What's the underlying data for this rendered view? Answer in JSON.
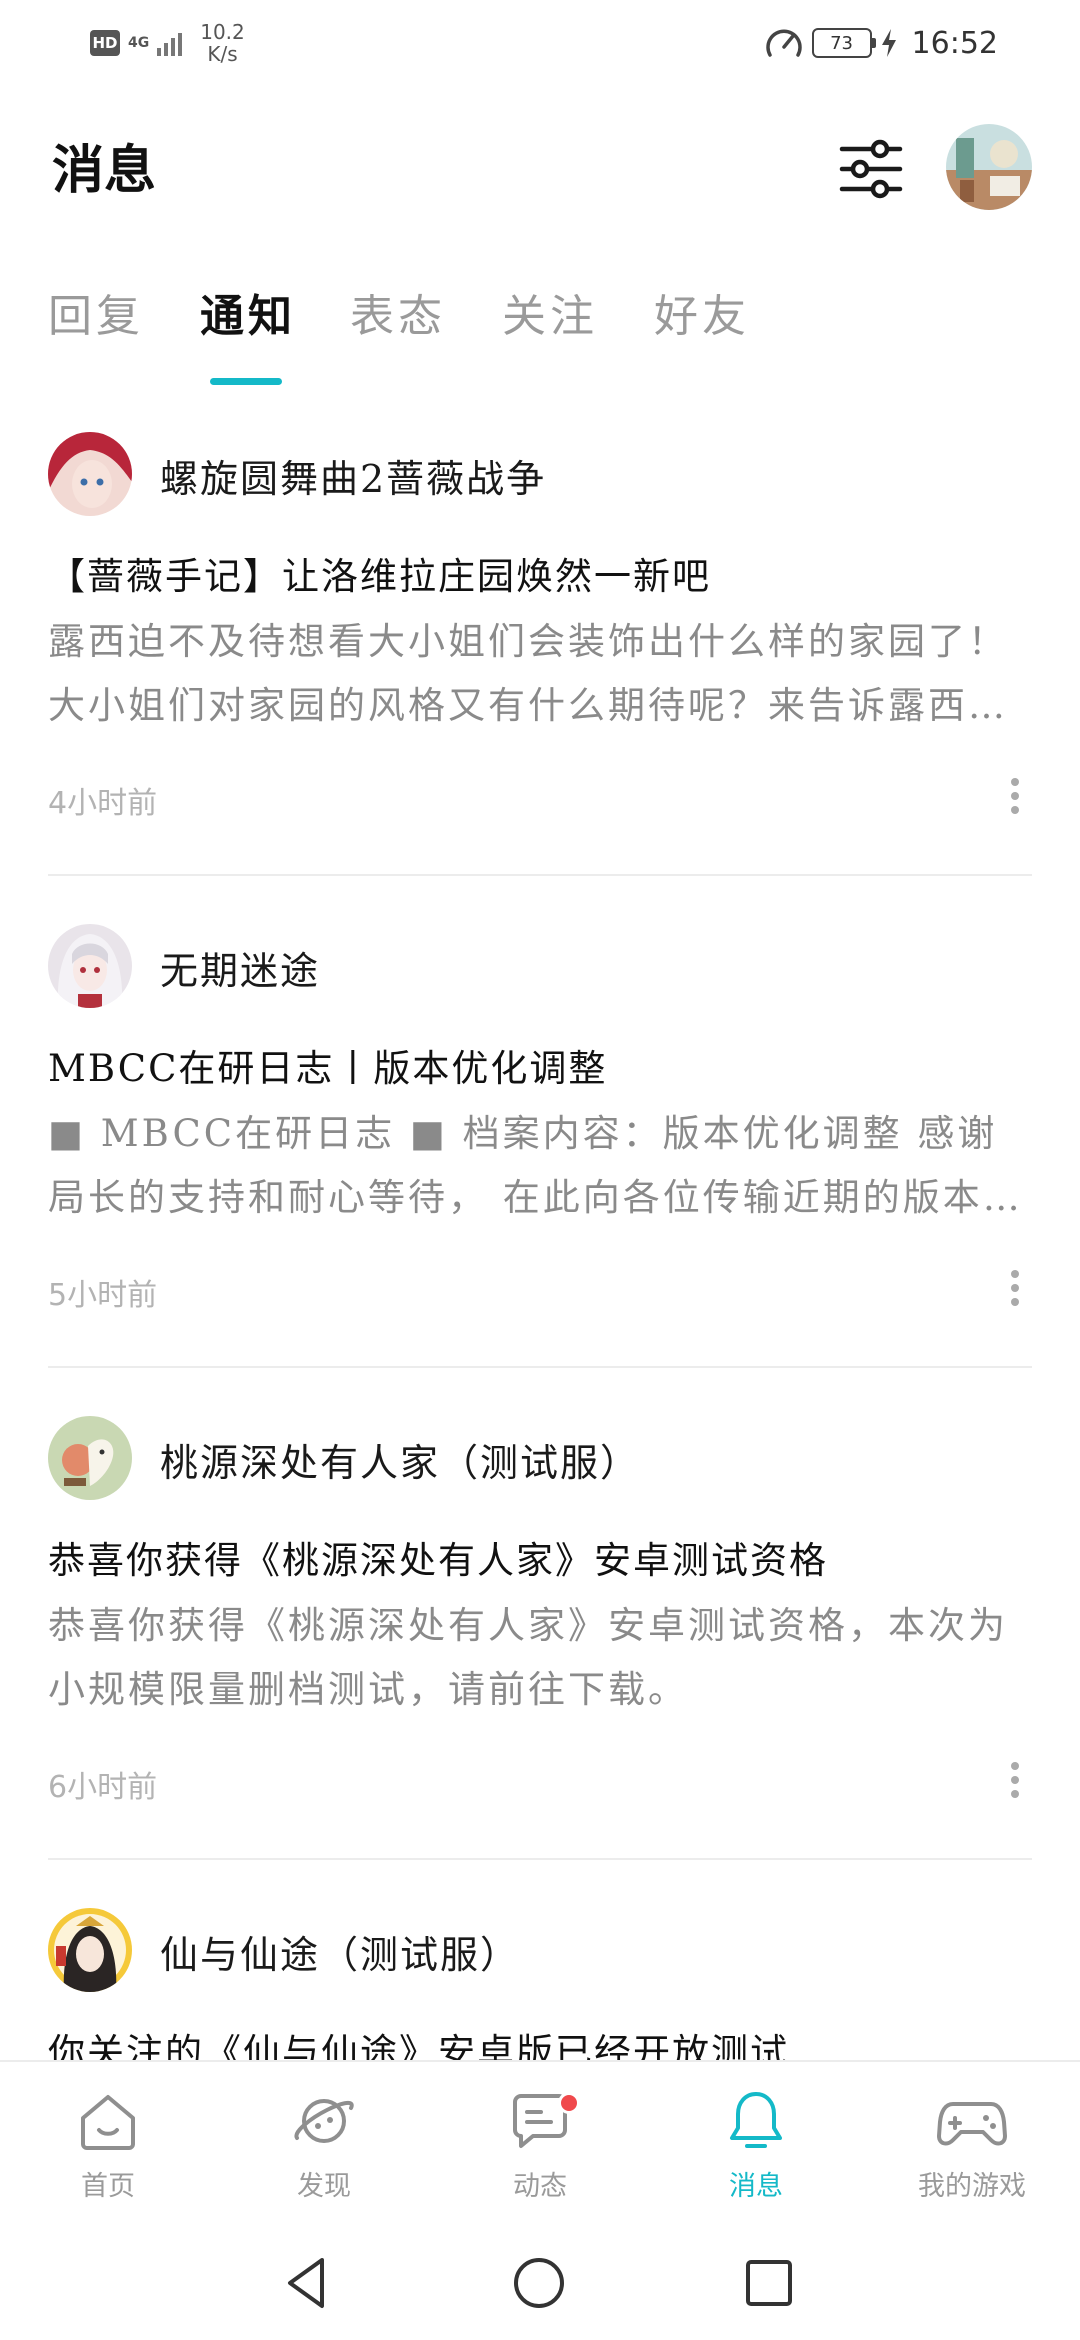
{
  "status_bar": {
    "hd": "HD",
    "network": "4G",
    "net_speed_value": "10.2",
    "net_speed_unit": "K/s",
    "battery": "73",
    "time": "16:52"
  },
  "header": {
    "title": "消息"
  },
  "tabs": [
    {
      "label": "回复",
      "active": false
    },
    {
      "label": "通知",
      "active": true
    },
    {
      "label": "表态",
      "active": false
    },
    {
      "label": "关注",
      "active": false
    },
    {
      "label": "好友",
      "active": false
    }
  ],
  "accent_color": "#14b9c8",
  "notifications": [
    {
      "source": "螺旋圆舞曲2蔷薇战争",
      "title": "【蔷薇手记】让洛维拉庄园焕然一新吧",
      "body": "露西迫不及待想看大小姐们会装饰出什么样的家园了！大小姐们对家园的风格又有什么期待呢？来告诉露西吧！",
      "time": "4小时前"
    },
    {
      "source": "无期迷途",
      "title": "MBCC在研日志丨版本优化调整",
      "body": "■ MBCC在研日志 ■ 档案内容：版本优化调整 感谢局长的支持和耐心等待， 在此向各位传输近期的版本优化内容。",
      "time": "5小时前"
    },
    {
      "source": "桃源深处有人家（测试服）",
      "title": "恭喜你获得《桃源深处有人家》安卓测试资格",
      "body": "恭喜你获得《桃源深处有人家》安卓测试资格，本次为小规模限量删档测试，请前往下载。",
      "time": "6小时前"
    },
    {
      "source": "仙与仙途（测试服）",
      "title": "你关注的《仙与仙途》安卓版已经开放测试",
      "body": "",
      "time": ""
    }
  ],
  "bottom_nav": [
    {
      "label": "首页",
      "icon": "home-icon",
      "active": false
    },
    {
      "label": "发现",
      "icon": "planet-icon",
      "active": false
    },
    {
      "label": "动态",
      "icon": "chat-bubble-icon",
      "active": false,
      "badge": true
    },
    {
      "label": "消息",
      "icon": "bell-icon",
      "active": true
    },
    {
      "label": "我的游戏",
      "icon": "gamepad-icon",
      "active": false
    }
  ]
}
